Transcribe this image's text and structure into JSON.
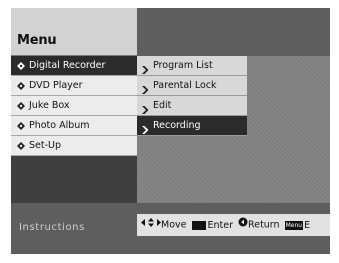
{
  "header": {
    "title": "Menu"
  },
  "sidebar": {
    "items": [
      {
        "label": "Digital Recorder",
        "selected": true
      },
      {
        "label": "DVD Player",
        "selected": false
      },
      {
        "label": "Juke Box",
        "selected": false
      },
      {
        "label": "Photo Album",
        "selected": false
      },
      {
        "label": "Set-Up",
        "selected": false
      }
    ]
  },
  "submenu": {
    "items": [
      {
        "label": "Program List",
        "selected": false
      },
      {
        "label": "Parental Lock",
        "selected": false
      },
      {
        "label": "Edit",
        "selected": false
      },
      {
        "label": "Recording",
        "selected": true
      }
    ]
  },
  "footer": {
    "label": "Instructions",
    "hints": {
      "move": "Move",
      "enter": "Enter",
      "return": "Return",
      "menu_key": "Menu",
      "exit_fragment": "E"
    }
  },
  "colors": {
    "selected_bg": "#2b2b2b",
    "item_bg": "#ececec",
    "header_dark": "#5f5f5f",
    "panel_gray": "#7f7f7f"
  }
}
